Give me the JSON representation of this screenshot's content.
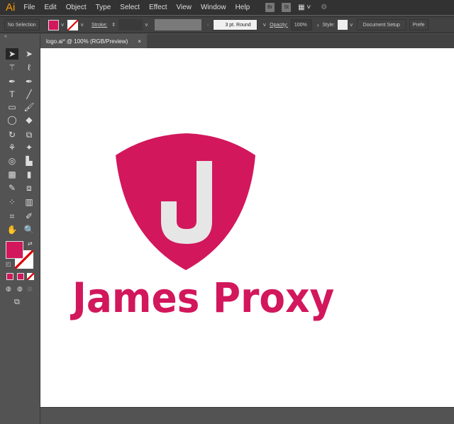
{
  "app": {
    "logo": "Ai"
  },
  "menu": [
    "File",
    "Edit",
    "Object",
    "Type",
    "Select",
    "Effect",
    "View",
    "Window",
    "Help"
  ],
  "menu_icons": {
    "bridge": "Br",
    "stock": "St"
  },
  "control": {
    "selection": "No Selection",
    "stroke_label": "Stroke:",
    "brush": "3 pt. Round",
    "opacity_label": "Opacity:",
    "opacity": "100%",
    "style_label": "Style:",
    "document_setup": "Document Setup",
    "preferences": "Prefe"
  },
  "tab": {
    "title": "logo.ai* @ 100% (RGB/Preview)",
    "close": "×"
  },
  "colors": {
    "fill": "#d2175c",
    "accent": "#ff9a00",
    "j": "#e6e6e6"
  },
  "artwork": {
    "letter": "J",
    "name": "James Proxy"
  }
}
